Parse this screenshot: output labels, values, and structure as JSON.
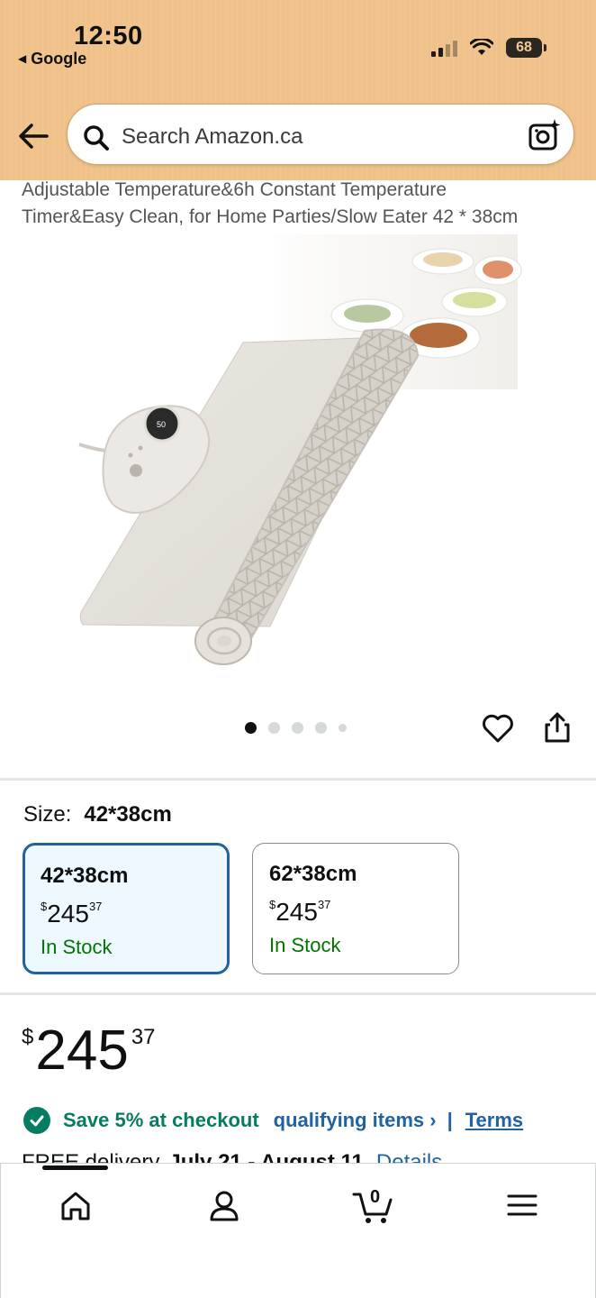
{
  "status_bar": {
    "time": "12:50",
    "back_app": "Google",
    "battery": "68"
  },
  "search": {
    "placeholder": "Search Amazon.ca"
  },
  "product": {
    "title_line1": "Adjustable Temperature&6h Constant Temperature",
    "title_line2": "Timer&Easy Clean, for Home Parties/Slow Eater 42 * 38cm",
    "image_count": 5,
    "active_image": 1
  },
  "size": {
    "label": "Size:",
    "selected": "42*38cm",
    "options": [
      {
        "name": "42*38cm",
        "currency": "$",
        "dollars": "245",
        "cents": "37",
        "stock": "In Stock",
        "selected": true
      },
      {
        "name": "62*38cm",
        "currency": "$",
        "dollars": "245",
        "cents": "37",
        "stock": "In Stock",
        "selected": false
      }
    ]
  },
  "price": {
    "currency": "$",
    "dollars": "245",
    "cents": "37"
  },
  "promo": {
    "save_text": "Save 5% at checkout",
    "qualifying_text": "qualifying items ›",
    "separator": "|",
    "terms": "Terms"
  },
  "delivery": {
    "prefix": "FREE delivery",
    "dates": "July 21 - August 11",
    "details": "Details"
  },
  "bottom_nav": {
    "cart_count": "0",
    "items": [
      "home-icon",
      "account-icon",
      "cart-icon",
      "menu-icon"
    ]
  },
  "colors": {
    "header": "#f1c48e",
    "link": "#2162a1",
    "in_stock": "#007600",
    "promo_green": "#067d62",
    "selected_border": "#2162a1",
    "selected_bg": "#edf8ff"
  }
}
